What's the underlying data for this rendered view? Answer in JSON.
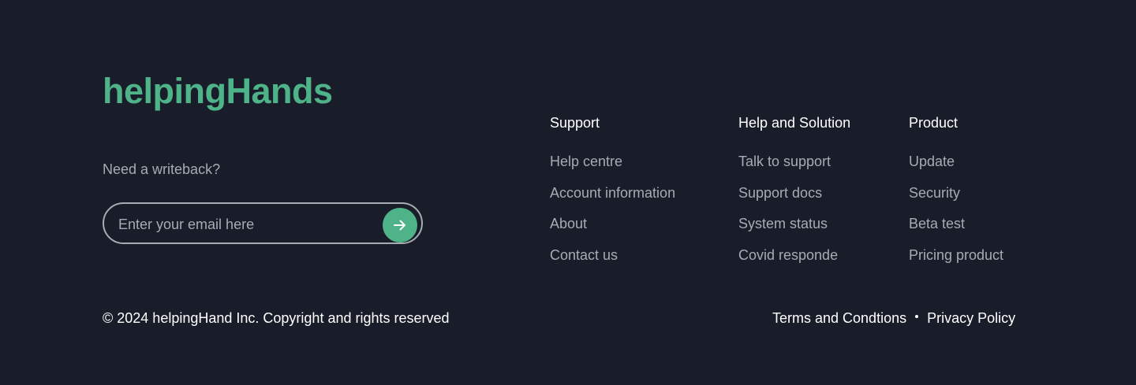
{
  "brand": {
    "logo_text": "helpingHands",
    "accent_color": "#4fb389",
    "background_color": "#181d29"
  },
  "newsletter": {
    "label": "Need a writeback?",
    "email_placeholder": "Enter your email here",
    "submit_icon": "arrow-right-icon"
  },
  "columns": [
    {
      "title": "Support",
      "links": [
        "Help centre",
        "Account information",
        "About",
        "Contact us"
      ]
    },
    {
      "title": "Help and Solution",
      "links": [
        "Talk to support",
        "Support docs",
        "System status",
        "Covid responde"
      ]
    },
    {
      "title": "Product",
      "links": [
        "Update",
        "Security",
        "Beta test",
        "Pricing product"
      ]
    }
  ],
  "footer": {
    "copyright": "© 2024 helpingHand Inc. Copyright and rights reserved",
    "terms_label": "Terms and Condtions",
    "privacy_label": "Privacy Policy"
  }
}
